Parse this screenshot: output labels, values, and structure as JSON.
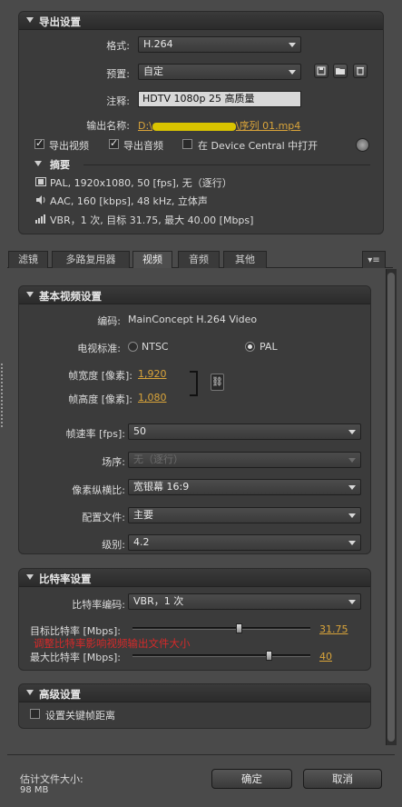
{
  "export_settings": {
    "title": "导出设置",
    "format_label": "格式:",
    "format_value": "H.264",
    "preset_label": "预置:",
    "preset_value": "自定",
    "comment_label": "注释:",
    "comment_value": "HDTV 1080p 25 高质量",
    "output_name_label": "输出名称:",
    "output_name_prefix": "D:\\",
    "output_name_suffix": "\\序列 01.mp4",
    "export_video_label": "导出视频",
    "export_audio_label": "导出音频",
    "open_device_central_label": "在 Device Central 中打开"
  },
  "summary": {
    "title": "摘要",
    "video_line": "PAL, 1920x1080, 50 [fps], 无（逐行）",
    "audio_line": "AAC, 160 [kbps], 48 kHz, 立体声",
    "bitrate_line": "VBR，1 次, 目标 31.75, 最大 40.00 [Mbps]"
  },
  "tabs": [
    "滤镜",
    "多路复用器",
    "视频",
    "音频",
    "其他"
  ],
  "basic_video": {
    "title": "基本视频设置",
    "codec_label": "编码:",
    "codec_value": "MainConcept H.264 Video",
    "tv_standard_label": "电视标准:",
    "ntsc_label": "NTSC",
    "pal_label": "PAL",
    "frame_width_label": "帧宽度 [像素]:",
    "frame_width_value": "1,920",
    "frame_height_label": "帧高度 [像素]:",
    "frame_height_value": "1,080",
    "frame_rate_label": "帧速率 [fps]:",
    "frame_rate_value": "50",
    "field_order_label": "场序:",
    "field_order_value": "无（逐行）",
    "pixel_aspect_label": "像素纵横比:",
    "pixel_aspect_value": "宽银幕 16:9",
    "profile_label": "配置文件:",
    "profile_value": "主要",
    "level_label": "级别:",
    "level_value": "4.2"
  },
  "bitrate": {
    "title": "比特率设置",
    "encoding_label": "比特率编码:",
    "encoding_value": "VBR，1 次",
    "target_label": "目标比特率 [Mbps]:",
    "target_value": "31.75",
    "target_fraction": 0.6,
    "max_label": "最大比特率 [Mbps]:",
    "max_value": "40",
    "max_fraction": 0.77,
    "annotation": "调整比特率影响视频输出文件大小"
  },
  "advanced": {
    "title": "高级设置",
    "keyframe_label": "设置关键帧距离"
  },
  "footer": {
    "estimated_size_label": "估计文件大小:",
    "estimated_size_value": "98 MB",
    "ok_label": "确定",
    "cancel_label": "取消"
  },
  "colors": {
    "link": "#d9a43a",
    "annotation": "#d42a2a",
    "redaction": "#d9c400"
  }
}
